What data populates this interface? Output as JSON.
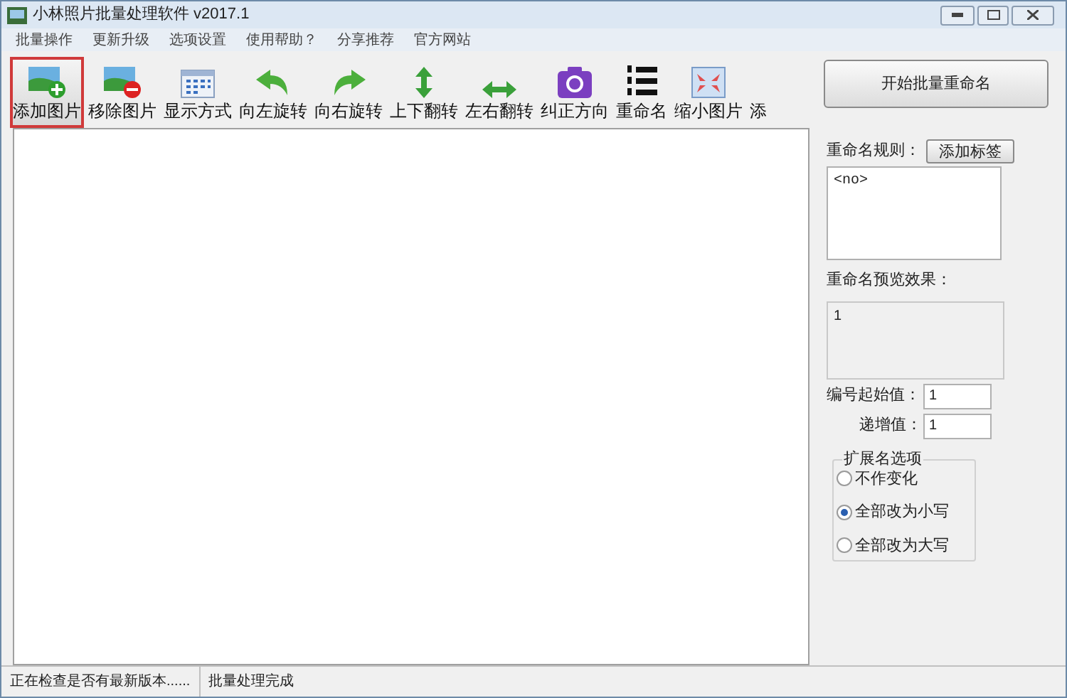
{
  "window": {
    "title": "小林照片批量处理软件 v2017.1"
  },
  "menu": [
    "批量操作",
    "更新升级",
    "选项设置",
    "使用帮助？",
    "分享推荐",
    "官方网站"
  ],
  "toolbar": [
    {
      "label": "添加图片",
      "kind": "add",
      "selected": true
    },
    {
      "label": "移除图片",
      "kind": "remove",
      "selected": false
    },
    {
      "label": "显示方式",
      "kind": "grid",
      "selected": false
    },
    {
      "label": "向左旋转",
      "kind": "rotate-left",
      "selected": false
    },
    {
      "label": "向右旋转",
      "kind": "rotate-right",
      "selected": false
    },
    {
      "label": "上下翻转",
      "kind": "flip-v",
      "selected": false
    },
    {
      "label": "左右翻转",
      "kind": "flip-h",
      "selected": false
    },
    {
      "label": "纠正方向",
      "kind": "camera",
      "selected": false
    },
    {
      "label": "重命名",
      "kind": "list",
      "selected": false
    },
    {
      "label": "缩小图片",
      "kind": "shrink",
      "selected": false
    },
    {
      "label": "添",
      "kind": "none",
      "selected": false
    }
  ],
  "start_button": "开始批量重命名",
  "rule": {
    "label": "重命名规则：",
    "button": "添加标签",
    "value": "<no>"
  },
  "preview": {
    "label": "重命名预览效果：",
    "value": "1"
  },
  "start_number": {
    "label": "编号起始值：",
    "value": "1"
  },
  "increment": {
    "label": "递增值：",
    "value": "1"
  },
  "extension": {
    "title": "扩展名选项",
    "options": [
      {
        "label": "不作变化",
        "selected": false
      },
      {
        "label": "全部改为小写",
        "selected": true
      },
      {
        "label": "全部改为大写",
        "selected": false
      }
    ]
  },
  "status_bar": [
    "正在检查是否有最新版本......",
    "批量处理完成"
  ]
}
